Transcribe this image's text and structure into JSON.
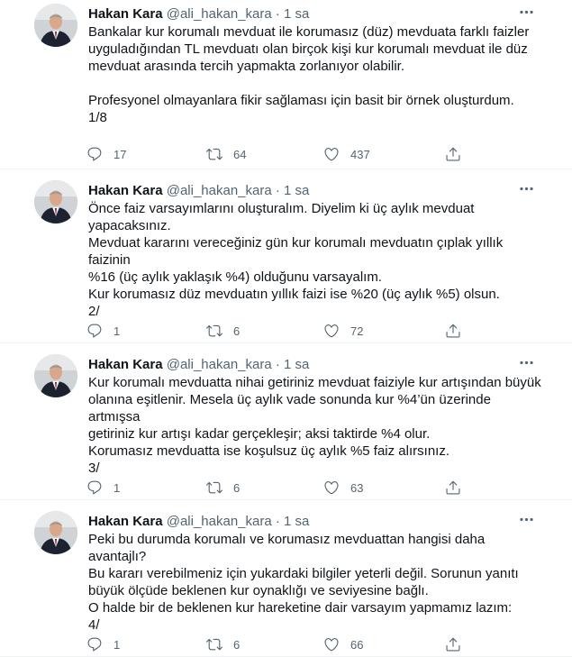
{
  "tweets": [
    {
      "name": "Hakan Kara",
      "handle": "@ali_hakan_kara",
      "dot": "·",
      "time": "1 sa",
      "lines": [
        "Bankalar kur korumalı mevduat ile korumasız (düz) mevduata farklı faizler",
        "uyguladığından TL mevduatı olan birçok kişi kur korumalı mevduat ile düz",
        "mevduat arasında tercih yapmakta zorlanıyor olabilir.",
        "",
        "Profesyonel olmayanlara fikir sağlaması için basit bir örnek oluşturdum.",
        "1/8"
      ],
      "replies": "17",
      "retweets": "64",
      "likes": "437"
    },
    {
      "name": "Hakan Kara",
      "handle": "@ali_hakan_kara",
      "dot": "·",
      "time": "1 sa",
      "lines": [
        "Önce faiz varsayımlarını oluşturalım. Diyelim ki üç aylık mevduat",
        "yapacaksınız.",
        "Mevduat kararını vereceğiniz gün kur korumalı mevduatın çıplak yıllık faizinin",
        "%16 (üç aylık yaklaşık %4) olduğunu varsayalım.",
        "Kur korumasız düz mevduatın yıllık faizi ise %20 (üç aylık %5) olsun.",
        "2/"
      ],
      "replies": "1",
      "retweets": "6",
      "likes": "72"
    },
    {
      "name": "Hakan Kara",
      "handle": "@ali_hakan_kara",
      "dot": "·",
      "time": "1 sa",
      "lines": [
        "Kur korumalı mevduatta nihai getiriniz mevduat faiziyle kur artışından büyük",
        "olanına eşitlenir. Mesela üç aylık vade sonunda kur %4’ün üzerinde artmışsa",
        "getiriniz kur artışı kadar gerçekleşir; aksi taktirde %4 olur.",
        "Korumasız mevduatta ise koşulsuz üç aylık %5 faiz alırsınız.",
        "3/"
      ],
      "replies": "1",
      "retweets": "6",
      "likes": "63"
    },
    {
      "name": "Hakan Kara",
      "handle": "@ali_hakan_kara",
      "dot": "·",
      "time": "1 sa",
      "lines": [
        "Peki bu durumda korumalı ve korumasız mevduattan hangisi daha avantajlı?",
        "Bu kararı verebilmeniz için yukardaki bilgiler yeterli değil. Sorunun yanıtı",
        "büyük ölçüde beklenen kur oynaklığı ve seviyesine bağlı.",
        "O halde bir de beklenen kur hareketine dair varsayım yapmamız lazım:",
        "4/"
      ],
      "replies": "1",
      "retweets": "6",
      "likes": "66"
    }
  ],
  "icons": {
    "reply": "reply-icon",
    "retweet": "retweet-icon",
    "like": "heart-icon",
    "share": "share-icon",
    "more": "more-options-icon"
  },
  "colors": {
    "text": "#0f1419",
    "secondary": "#536471",
    "divider": "#eff3f4"
  }
}
